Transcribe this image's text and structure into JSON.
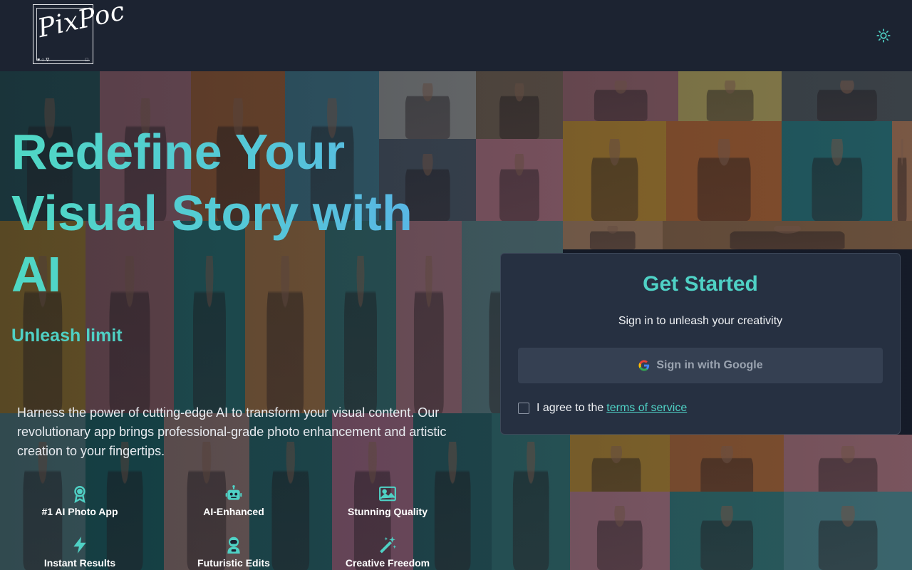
{
  "brand": {
    "logo_text": "PixPoc",
    "logo_glyphs": "♥○∇",
    "logo_glyph_right": "□"
  },
  "header": {
    "theme_toggle_icon": "sun-icon"
  },
  "hero": {
    "headline": "Redefine Your Visual Story with AI",
    "tagline": "Unleash limit",
    "description": "Harness the power of cutting-edge AI to transform your visual content. Our revolutionary app brings professional-grade photo enhancement and artistic creation to your fingertips.",
    "features": [
      {
        "label": "#1 AI Photo App",
        "icon": "award-icon"
      },
      {
        "label": "AI-Enhanced",
        "icon": "robot-icon"
      },
      {
        "label": "Stunning Quality",
        "icon": "image-icon"
      },
      {
        "label": "Instant Results",
        "icon": "lightning-icon"
      },
      {
        "label": "Futuristic Edits",
        "icon": "astronaut-icon"
      },
      {
        "label": "Creative Freedom",
        "icon": "magic-wand-icon"
      }
    ]
  },
  "signin": {
    "title": "Get Started",
    "subtitle": "Sign in to unleash your creativity",
    "google_button": "Sign in with Google",
    "agree_prefix": "I agree to the",
    "terms_link": "terms of service"
  },
  "colors": {
    "accent": "#4fd1c5",
    "header_bg": "#1c2331",
    "card_bg": "#263041"
  }
}
